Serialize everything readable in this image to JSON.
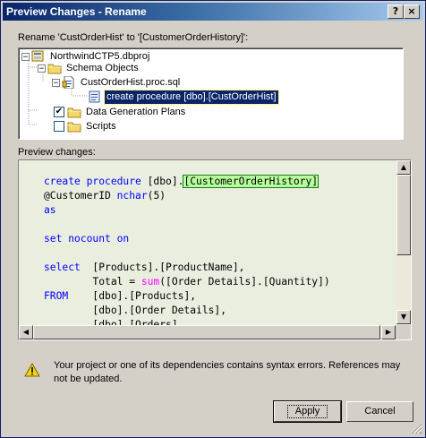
{
  "window": {
    "title": "Preview Changes - Rename",
    "help_glyph": "?",
    "close_glyph": "×"
  },
  "rename_label": "Rename 'CustOrderHist' to '[CustomerOrderHistory]':",
  "tree": {
    "items": [
      {
        "label": "NorthwindCTP5.dbproj",
        "expander": "−",
        "icon": "project-icon"
      },
      {
        "label": "Schema Objects",
        "expander": "−",
        "icon": "folder-icon"
      },
      {
        "label": "CustOrderHist.proc.sql",
        "expander": "−",
        "icon": "sql-file-icon"
      },
      {
        "label": "create procedure [dbo].[CustOrderHist]",
        "icon": "procedure-icon",
        "selected": true
      },
      {
        "label": "Data Generation Plans",
        "checked": true,
        "check_glyph": "✔",
        "icon": "folder-icon"
      },
      {
        "label": "Scripts",
        "checked": false,
        "check_glyph": "",
        "icon": "folder-icon"
      }
    ]
  },
  "preview_label": "Preview changes:",
  "code": {
    "line1": {
      "kw": "create procedure",
      "plain": " [dbo].",
      "highlight": "[CustomerOrderHistory]"
    },
    "line2": {
      "plain": "@CustomerID ",
      "kw": "nchar",
      "rest": "(5)"
    },
    "line3": {
      "kw": "as"
    },
    "line5": {
      "kw": "set nocount on"
    },
    "line7": {
      "kw": "select",
      "plain": "  [Products].[ProductName],"
    },
    "line8": {
      "plain": "        Total = ",
      "fn": "sum",
      "rest": "([Order Details].[Quantity])"
    },
    "line9": {
      "kw": "FROM",
      "plain": "    [dbo].[Products],"
    },
    "line10": {
      "plain": "        [dbo].[Order Details],"
    },
    "line11": {
      "plain": "        [dbo].[Orders]"
    }
  },
  "warning": {
    "icon": "warning-icon",
    "text": "Your project or one of its dependencies contains syntax errors. References may not be updated."
  },
  "buttons": {
    "apply": "Apply",
    "cancel": "Cancel"
  }
}
